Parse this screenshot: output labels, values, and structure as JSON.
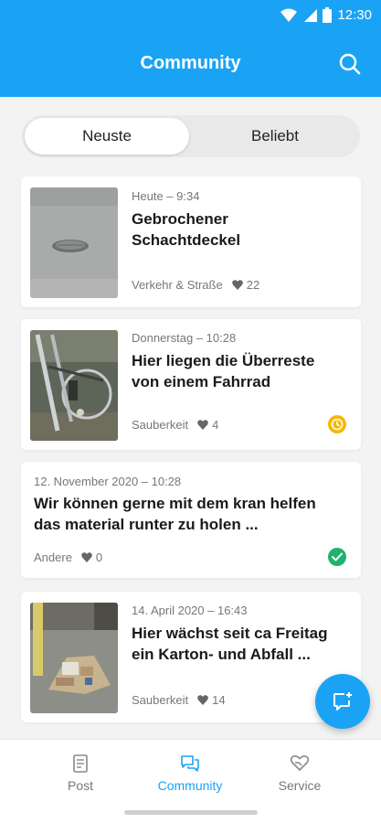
{
  "status_bar": {
    "time": "12:30"
  },
  "header": {
    "title": "Community"
  },
  "tabs": [
    {
      "label": "Neuste",
      "active": true
    },
    {
      "label": "Beliebt",
      "active": false
    }
  ],
  "posts": [
    {
      "time": "Heute – 9:34",
      "title_line1": "Gebrochener",
      "title_line2": "Schachtdeckel",
      "category": "Verkehr & Straße",
      "likes": "22",
      "status": "none",
      "image": "manhole-cover-photo"
    },
    {
      "time": "Donnerstag – 10:28",
      "title_line1": "Hier liegen die Überreste",
      "title_line2": "von einem Fahrrad",
      "category": "Sauberkeit",
      "likes": "4",
      "status": "pending",
      "image": "bicycle-photo"
    },
    {
      "time": "12. November 2020 – 10:28",
      "title_line1": "Wir können gerne mit dem kran helfen",
      "title_line2": "das material runter zu holen ...",
      "category": "Andere",
      "likes": "0",
      "status": "done",
      "image": ""
    },
    {
      "time": "14. April 2020 – 16:43",
      "title_line1": "Hier wächst seit ca Freitag",
      "title_line2": "ein Karton- und Abfall ...",
      "category": "Sauberkeit",
      "likes": "14",
      "status": "none",
      "image": "trash-pile-photo"
    }
  ],
  "bottom_nav": [
    {
      "label": "Post",
      "icon": "document-icon",
      "active": false
    },
    {
      "label": "Community",
      "icon": "chat-icon",
      "active": true
    },
    {
      "label": "Service",
      "icon": "heart-hand-icon",
      "active": false
    }
  ],
  "colors": {
    "primary": "#1aa3f5",
    "pending": "#f5b800",
    "done": "#1fb36b"
  }
}
